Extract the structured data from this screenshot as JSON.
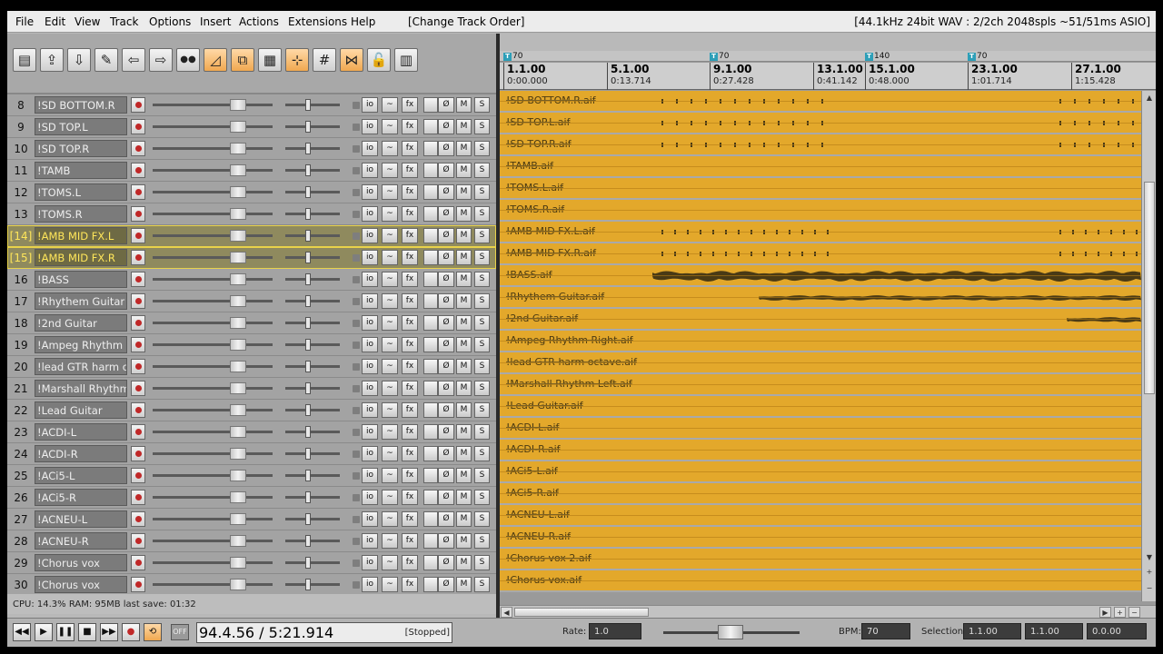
{
  "menu": [
    "File",
    "Edit",
    "View",
    "Track",
    "Options",
    "Insert",
    "Actions",
    "Extensions",
    "Help"
  ],
  "window_title": "[Change Track Order]",
  "audio_status": "[44.1kHz 24bit WAV : 2/2ch 2048spls ~51/51ms ASIO]",
  "toolbar_icons": [
    "new-project-icon",
    "open-project-icon",
    "save-project-icon",
    "wrench-icon",
    "undo-icon",
    "redo-icon",
    "metronome-icon",
    "ripple-icon",
    "grouping-icon",
    "grid-lines-icon",
    "snap-icon",
    "grid-icon",
    "crossfade-icon",
    "lock-icon",
    "midi-keyboard-icon"
  ],
  "toolbar_on": [
    7,
    8,
    10,
    12
  ],
  "tracks": [
    {
      "num": "8",
      "name": "!SD BOTTOM.R",
      "clip": "!SD BOTTOM.R.aif",
      "sel": false
    },
    {
      "num": "9",
      "name": "!SD TOP.L",
      "clip": "!SD TOP.L.aif",
      "sel": false
    },
    {
      "num": "10",
      "name": "!SD TOP.R",
      "clip": "!SD TOP.R.aif",
      "sel": false
    },
    {
      "num": "11",
      "name": "!TAMB",
      "clip": "!TAMB.aif",
      "sel": false
    },
    {
      "num": "12",
      "name": "!TOMS.L",
      "clip": "!TOMS.L.aif",
      "sel": false
    },
    {
      "num": "13",
      "name": "!TOMS.R",
      "clip": "!TOMS.R.aif",
      "sel": false
    },
    {
      "num": "[14]",
      "name": "!AMB MID FX.L",
      "clip": "!AMB MID FX.L.aif",
      "sel": true
    },
    {
      "num": "[15]",
      "name": "!AMB MID FX.R",
      "clip": "!AMB MID FX.R.aif",
      "sel": true
    },
    {
      "num": "16",
      "name": "!BASS",
      "clip": "!BASS.aif",
      "sel": false
    },
    {
      "num": "17",
      "name": "!Rhythem Guitar",
      "clip": "!Rhythem Guitar.aif",
      "sel": false
    },
    {
      "num": "18",
      "name": "!2nd Guitar",
      "clip": "!2nd Guitar.aif",
      "sel": false
    },
    {
      "num": "19",
      "name": "!Ampeg Rhythm Righ",
      "clip": "!Ampeg Rhythm Right.aif",
      "sel": false
    },
    {
      "num": "20",
      "name": "!lead GTR harm octa",
      "clip": "!lead GTR harm octave.aif",
      "sel": false
    },
    {
      "num": "21",
      "name": "!Marshall Rhythm Lef",
      "clip": "!Marshall Rhythm Left.aif",
      "sel": false
    },
    {
      "num": "22",
      "name": "!Lead Guitar",
      "clip": "!Lead Guitar.aif",
      "sel": false
    },
    {
      "num": "23",
      "name": "!ACDI-L",
      "clip": "!ACDI-L.aif",
      "sel": false
    },
    {
      "num": "24",
      "name": "!ACDI-R",
      "clip": "!ACDI-R.aif",
      "sel": false
    },
    {
      "num": "25",
      "name": "!ACi5-L",
      "clip": "!ACi5-L.aif",
      "sel": false
    },
    {
      "num": "26",
      "name": "!ACi5-R",
      "clip": "!ACi5-R.aif",
      "sel": false
    },
    {
      "num": "27",
      "name": "!ACNEU-L",
      "clip": "!ACNEU-L.aif",
      "sel": false
    },
    {
      "num": "28",
      "name": "!ACNEU-R",
      "clip": "!ACNEU-R.aif",
      "sel": false
    },
    {
      "num": "29",
      "name": "!Chorus vox",
      "clip": "!Chorus vox 2.aif",
      "sel": false
    },
    {
      "num": "30",
      "name": "!Chorus vox",
      "clip": "!Chorus vox.aif",
      "sel": false
    }
  ],
  "track_buttons": {
    "io": "io",
    "env": "~",
    "fx": "fx",
    "phase": "Ø",
    "mute": "M",
    "solo": "S"
  },
  "tempo_markers": [
    {
      "pos": "1.1.00",
      "bpm": "70"
    },
    {
      "pos": "9.1.00",
      "bpm": "70"
    },
    {
      "pos": "15.1.00",
      "bpm": "140"
    },
    {
      "pos": "23.1.00",
      "bpm": "70"
    }
  ],
  "tempo_marker_glyph": "T",
  "ruler_marks": [
    {
      "bar": "1.1.00",
      "time": "0:00.000"
    },
    {
      "bar": "5.1.00",
      "time": "0:13.714"
    },
    {
      "bar": "9.1.00",
      "time": "0:27.428"
    },
    {
      "bar": "13.1.00",
      "time": "0:41.142"
    },
    {
      "bar": "15.1.00",
      "time": "0:48.000"
    },
    {
      "bar": "23.1.00",
      "time": "1:01.714"
    },
    {
      "bar": "27.1.00",
      "time": "1:15.428"
    }
  ],
  "status_line": "CPU: 14.3%  RAM: 95MB  last save: 01:32",
  "transport": {
    "buttons": [
      "go-to-start-icon",
      "play-icon",
      "pause-icon",
      "stop-icon",
      "go-to-end-icon",
      "record-icon",
      "repeat-icon"
    ],
    "glyphs": [
      "◀◀",
      "▶",
      "❚❚",
      "■",
      "▶▶",
      "●",
      "⟲"
    ],
    "off_label": "OFF",
    "time": "94.4.56 / 5:21.914",
    "state": "[Stopped]",
    "rate_label": "Rate:",
    "rate_value": "1.0",
    "bpm_label": "BPM:",
    "bpm_value": "70",
    "selection_label": "Selection:",
    "sel_start": "1.1.00",
    "sel_end": "1.1.00",
    "sel_len": "0.0.00"
  },
  "colors": {
    "item": "#e3a82b",
    "selected_track": "#ffe65a",
    "record": "#c02828",
    "tempo_marker": "#2d9fb8"
  }
}
